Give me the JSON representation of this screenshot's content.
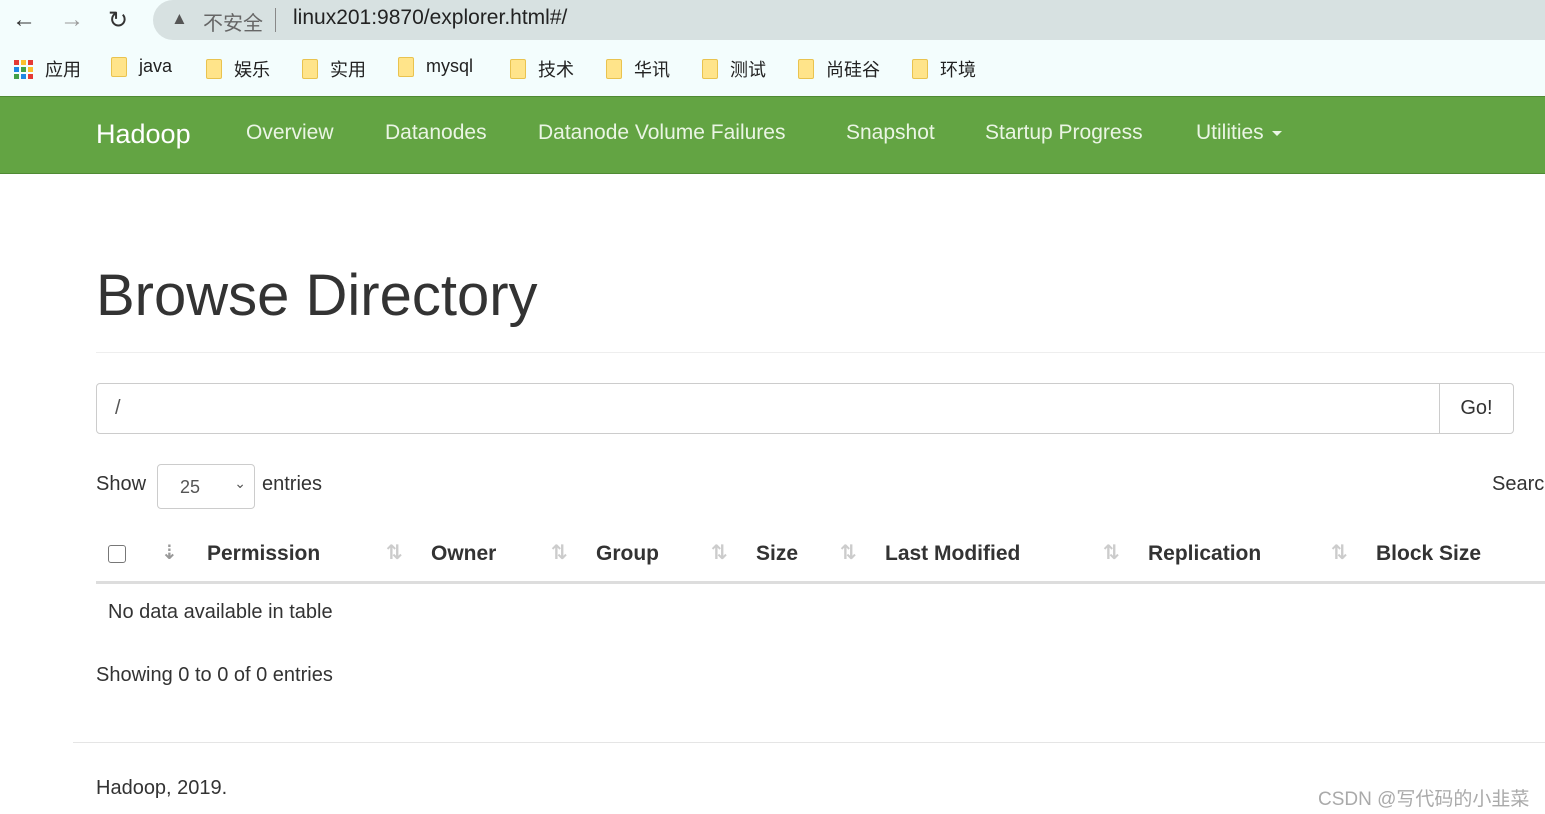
{
  "browser": {
    "insecure_label": "不安全",
    "url": "linux201:9870/explorer.html#/",
    "bookmarks": [
      "应用",
      "java",
      "娱乐",
      "实用",
      "mysql",
      "技术",
      "华讯",
      "测试",
      "尚硅谷",
      "环境"
    ]
  },
  "navbar": {
    "brand": "Hadoop",
    "items": [
      "Overview",
      "Datanodes",
      "Datanode Volume Failures",
      "Snapshot",
      "Startup Progress",
      "Utilities"
    ],
    "color": "#63a443"
  },
  "page": {
    "title": "Browse Directory",
    "path_value": "/",
    "go_label": "Go!",
    "show_label": "Show",
    "entries_value": "25",
    "entries_label": "entries",
    "search_label": "Searc",
    "columns": [
      "Permission",
      "Owner",
      "Group",
      "Size",
      "Last Modified",
      "Replication",
      "Block Size"
    ],
    "empty_message": "No data available in table",
    "info": "Showing 0 to 0 of 0 entries"
  },
  "footer": {
    "text": "Hadoop, 2019."
  },
  "watermark": "CSDN @写代码的小韭菜"
}
